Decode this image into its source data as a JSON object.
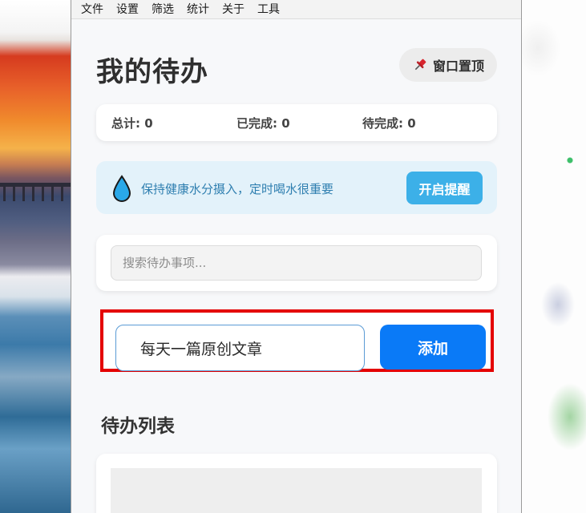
{
  "menubar": {
    "items": [
      "文件",
      "设置",
      "筛选",
      "统计",
      "关于",
      "工具"
    ]
  },
  "header": {
    "title": "我的待办",
    "pin_label": "窗口置顶"
  },
  "stats": {
    "total": "总计: 0",
    "completed": "已完成: 0",
    "pending": "待完成: 0"
  },
  "water": {
    "message": "保持健康水分摄入，定时喝水很重要",
    "button_label": "开启提醒"
  },
  "search": {
    "placeholder": "搜索待办事项..."
  },
  "add": {
    "input_value": "每天一篇原创文章",
    "button_label": "添加"
  },
  "list": {
    "title": "待办列表"
  },
  "colors": {
    "accent": "#0a7af7",
    "remind_button": "#3cb0e8",
    "highlight_border": "#e40000",
    "water_banner": "#e3f2fa"
  }
}
